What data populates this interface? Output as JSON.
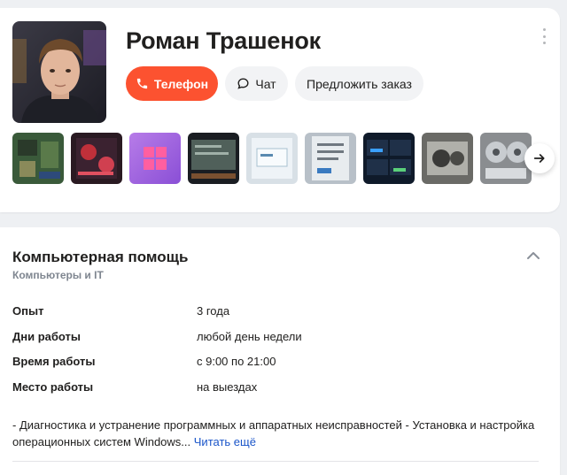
{
  "profile": {
    "name": "Роман Трашенок",
    "buttons": {
      "phone": "Телефон",
      "chat": "Чат",
      "order": "Предложить заказ"
    },
    "icons": {
      "phone": "phone-icon",
      "chat": "chat-bubble-icon",
      "more": "more-vertical-icon",
      "next": "arrow-right-icon"
    },
    "gallery": [
      {
        "name": "photo-motherboard-1"
      },
      {
        "name": "photo-pc-case-rgb"
      },
      {
        "name": "photo-windows-logo"
      },
      {
        "name": "photo-monitor-screen"
      },
      {
        "name": "photo-installer-screen"
      },
      {
        "name": "photo-setup-screen"
      },
      {
        "name": "photo-monitoring-screen"
      },
      {
        "name": "photo-gpu"
      },
      {
        "name": "photo-fans"
      }
    ]
  },
  "service": {
    "title": "Компьютерная помощь",
    "category": "Компьютеры и IT",
    "details": [
      {
        "label": "Опыт",
        "value": "3 года"
      },
      {
        "label": "Дни работы",
        "value": "любой день недели"
      },
      {
        "label": "Время работы",
        "value": "с 9:00 по 21:00"
      },
      {
        "label": "Место работы",
        "value": "на выездах"
      }
    ],
    "description": "- Диагностика и устранение программных и аппаратных неисправностей - Установка и настройка операционных систем Windows...",
    "read_more": "Читать ещё"
  },
  "colors": {
    "accent": "#fc5230",
    "link": "#1a55c9",
    "muted": "#7f8690"
  }
}
